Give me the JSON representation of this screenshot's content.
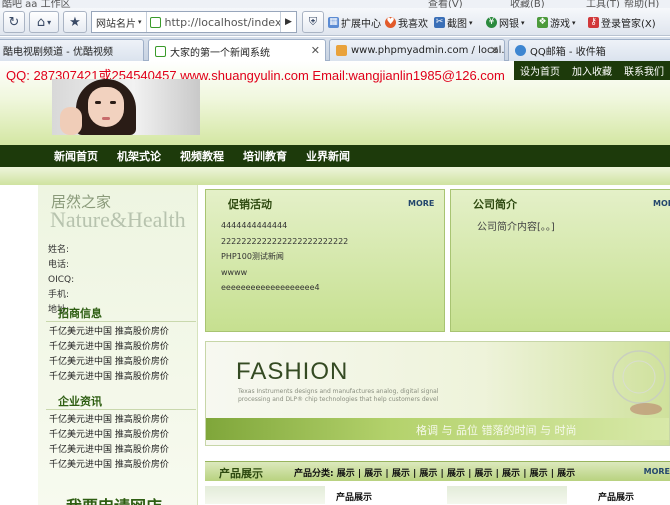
{
  "menu_strip": {
    "left_text": "酷吧 aa 工作区",
    "right_items": [
      "查看(V)",
      "收藏(B)",
      "工具(T)",
      "帮助(H)"
    ]
  },
  "toolbar": {
    "refresh_icon": "refresh-icon",
    "home_icon": "home-icon",
    "favorites_icon": "star-icon",
    "site_label": "网站名片",
    "url": "http://localhost/index",
    "go_icon": "play-icon",
    "shield_icon": "shield-icon",
    "extensions": "扩展中心",
    "likes": "我喜欢",
    "screenshot": "截图",
    "wangyin": "网银",
    "games": "游戏",
    "login": "登录管家(X)"
  },
  "tabs": [
    {
      "label": "酷电视剧频道 - 优酷视频",
      "active": false
    },
    {
      "label": "大家的第一个新闻系统",
      "active": true
    },
    {
      "label": "www.phpmyadmin.com / local...",
      "active": false
    },
    {
      "label": "QQ邮箱 - 收件箱",
      "active": false
    }
  ],
  "site": {
    "contact": "QQ: 287307421或254540457 www.shuangyulin.com Email:wangjianlin1985@126.com",
    "top_links": [
      "设为首页",
      "加入收藏",
      "联系我们"
    ],
    "nav": [
      "新闻首页",
      "机架式论",
      "视频教程",
      "培训教育",
      "业界新闻"
    ]
  },
  "left": {
    "brand_cn": "居然之家",
    "brand_en": "Nature&Health",
    "info_labels": [
      "姓名:",
      "电话:",
      "OICQ:",
      "手机:",
      "地址:"
    ],
    "section1_title": "招商信息",
    "section1_items": [
      "千亿美元进中国 推高股价房价",
      "千亿美元进中国 推高股价房价",
      "千亿美元进中国 推高股价房价",
      "千亿美元进中国 推高股价房价"
    ],
    "section2_title": "企业资讯",
    "section2_items": [
      "千亿美元进中国 推高股价房价",
      "千亿美元进中国 推高股价房价",
      "千亿美元进中国 推高股价房价",
      "千亿美元进中国 推高股价房价"
    ],
    "bottom_title": "我要申请网店"
  },
  "promo": {
    "title": "促销活动",
    "more": "MORE",
    "items": [
      "4444444444444",
      "2222222222222222222222222",
      "PHP100测试新闻",
      "wwww",
      "eeeeeeeeeeeeeeeeeee4"
    ]
  },
  "company": {
    "title": "公司简介",
    "more": "MORE",
    "content": "公司简介内容[。。]"
  },
  "fashion": {
    "title": "FASHION",
    "line1": "Texas Instruments designs and manufactures analog, digital signal",
    "line2": "processing and DLP® chip technologies that help customers devel",
    "slogan": "格调 与 品位    错落的时间 与 时尚"
  },
  "products": {
    "title": "产品展示",
    "category_text": "产品分类: 展示 | 展示 | 展示 | 展示 | 展示 | 展示 | 展示 | 展示 | 展示",
    "more": "MORE",
    "item_labels": [
      "产品展示",
      "产品展示"
    ]
  }
}
